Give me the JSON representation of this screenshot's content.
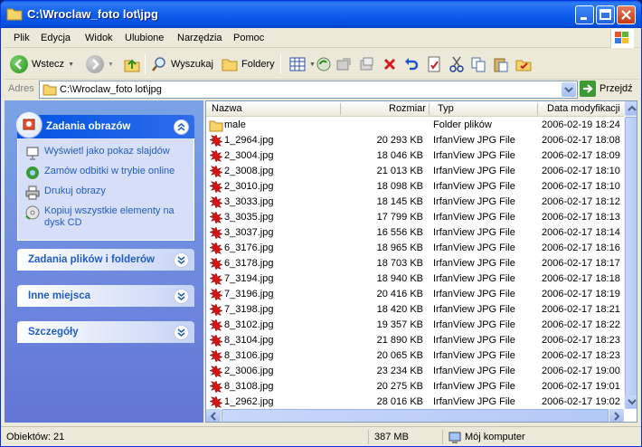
{
  "window": {
    "title": "C:\\Wroclaw_foto lot\\jpg"
  },
  "menu": [
    "Plik",
    "Edycja",
    "Widok",
    "Ulubione",
    "Narzędzia",
    "Pomoc"
  ],
  "toolbar": {
    "back_label": "Wstecz",
    "search_label": "Wyszukaj",
    "folders_label": "Foldery"
  },
  "address": {
    "label": "Adres",
    "value": "C:\\Wroclaw_foto lot\\jpg",
    "go_label": "Przejdź"
  },
  "taskpane": {
    "picture_tasks": {
      "title": "Zadania obrazów",
      "items": [
        {
          "label": "Wyświetl jako pokaz slajdów",
          "icon": "slideshow-icon"
        },
        {
          "label": "Zamów odbitki w trybie online",
          "icon": "order-prints-icon"
        },
        {
          "label": "Drukuj obrazy",
          "icon": "print-icon"
        },
        {
          "label": "Kopiuj wszystkie elementy na dysk CD",
          "icon": "cd-copy-icon"
        }
      ]
    },
    "file_tasks_title": "Zadania plików i folderów",
    "other_places_title": "Inne miejsca",
    "details_title": "Szczegóły"
  },
  "columns": {
    "name": "Nazwa",
    "size": "Rozmiar",
    "type": "Typ",
    "date": "Data modyfikacji"
  },
  "files": [
    {
      "name": "male",
      "size": "",
      "type": "Folder plików",
      "date": "2006-02-19 18:24",
      "folder": true
    },
    {
      "name": "1_2964.jpg",
      "size": "20 293 KB",
      "type": "IrfanView JPG File",
      "date": "2006-02-17 18:08"
    },
    {
      "name": "2_3004.jpg",
      "size": "18 046 KB",
      "type": "IrfanView JPG File",
      "date": "2006-02-17 18:09"
    },
    {
      "name": "2_3008.jpg",
      "size": "21 013 KB",
      "type": "IrfanView JPG File",
      "date": "2006-02-17 18:10"
    },
    {
      "name": "2_3010.jpg",
      "size": "18 098 KB",
      "type": "IrfanView JPG File",
      "date": "2006-02-17 18:10"
    },
    {
      "name": "3_3033.jpg",
      "size": "18 145 KB",
      "type": "IrfanView JPG File",
      "date": "2006-02-17 18:12"
    },
    {
      "name": "3_3035.jpg",
      "size": "17 799 KB",
      "type": "IrfanView JPG File",
      "date": "2006-02-17 18:13"
    },
    {
      "name": "3_3037.jpg",
      "size": "16 556 KB",
      "type": "IrfanView JPG File",
      "date": "2006-02-17 18:14"
    },
    {
      "name": "6_3176.jpg",
      "size": "18 965 KB",
      "type": "IrfanView JPG File",
      "date": "2006-02-17 18:16"
    },
    {
      "name": "6_3178.jpg",
      "size": "18 703 KB",
      "type": "IrfanView JPG File",
      "date": "2006-02-17 18:17"
    },
    {
      "name": "7_3194.jpg",
      "size": "18 940 KB",
      "type": "IrfanView JPG File",
      "date": "2006-02-17 18:18"
    },
    {
      "name": "7_3196.jpg",
      "size": "20 416 KB",
      "type": "IrfanView JPG File",
      "date": "2006-02-17 18:19"
    },
    {
      "name": "7_3198.jpg",
      "size": "18 420 KB",
      "type": "IrfanView JPG File",
      "date": "2006-02-17 18:21"
    },
    {
      "name": "8_3102.jpg",
      "size": "19 357 KB",
      "type": "IrfanView JPG File",
      "date": "2006-02-17 18:22"
    },
    {
      "name": "8_3104.jpg",
      "size": "21 890 KB",
      "type": "IrfanView JPG File",
      "date": "2006-02-17 18:23"
    },
    {
      "name": "8_3106.jpg",
      "size": "20 065 KB",
      "type": "IrfanView JPG File",
      "date": "2006-02-17 18:23"
    },
    {
      "name": "2_3006.jpg",
      "size": "23 234 KB",
      "type": "IrfanView JPG File",
      "date": "2006-02-17 19:00"
    },
    {
      "name": "8_3108.jpg",
      "size": "20 275 KB",
      "type": "IrfanView JPG File",
      "date": "2006-02-17 19:01"
    },
    {
      "name": "1_2962.jpg",
      "size": "28 016 KB",
      "type": "IrfanView JPG File",
      "date": "2006-02-17 19:02"
    }
  ],
  "status": {
    "objects": "Obiektów: 21",
    "size": "387 MB",
    "location": "Mój komputer"
  },
  "colors": {
    "title_blue": "#0054e3",
    "pane_blue": "#6375d6",
    "link_blue": "#215dc6"
  }
}
